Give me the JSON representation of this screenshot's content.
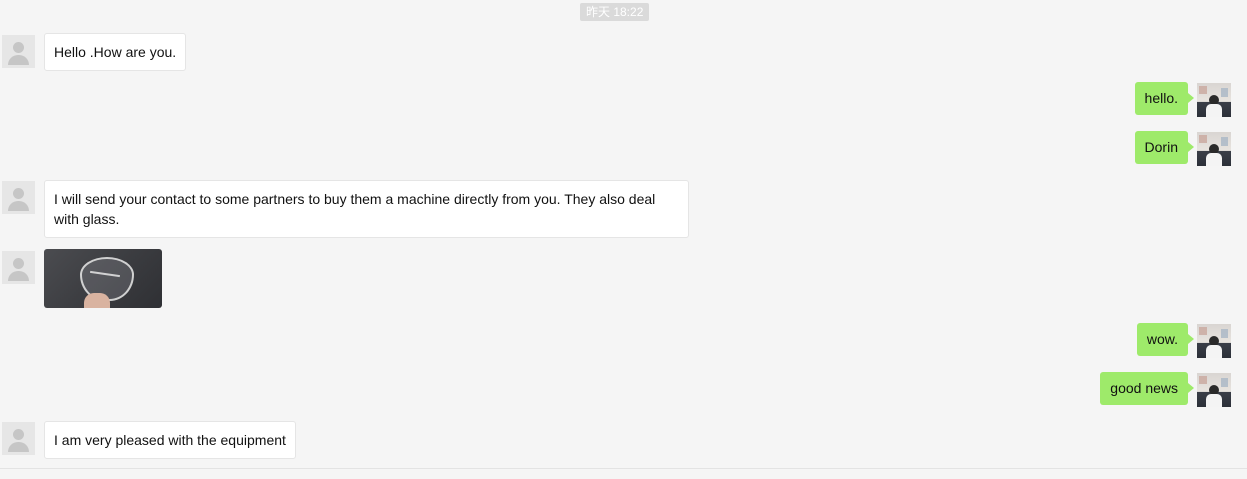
{
  "chat": {
    "timestamp": "昨天 18:22",
    "messages": [
      {
        "side": "left",
        "type": "text",
        "text": "Hello .How are you."
      },
      {
        "side": "right",
        "type": "text",
        "text": "hello."
      },
      {
        "side": "right",
        "type": "text",
        "text": "Dorin"
      },
      {
        "side": "left",
        "type": "text",
        "text": "I will send your contact to some partners to buy them a machine directly from you. They also deal with glass."
      },
      {
        "side": "left",
        "type": "image",
        "text": ""
      },
      {
        "side": "right",
        "type": "text",
        "text": "wow."
      },
      {
        "side": "right",
        "type": "text",
        "text": "good news"
      },
      {
        "side": "left",
        "type": "text",
        "text": "I am very pleased with the equipment"
      }
    ]
  },
  "colors": {
    "background": "#f5f5f5",
    "sent_bubble": "#9eea6a",
    "received_bubble": "#ffffff",
    "timestamp_bg": "#dadada"
  },
  "icons": {
    "contact_avatar": "default-person-avatar-icon",
    "own_avatar": "user-photo-avatar"
  }
}
